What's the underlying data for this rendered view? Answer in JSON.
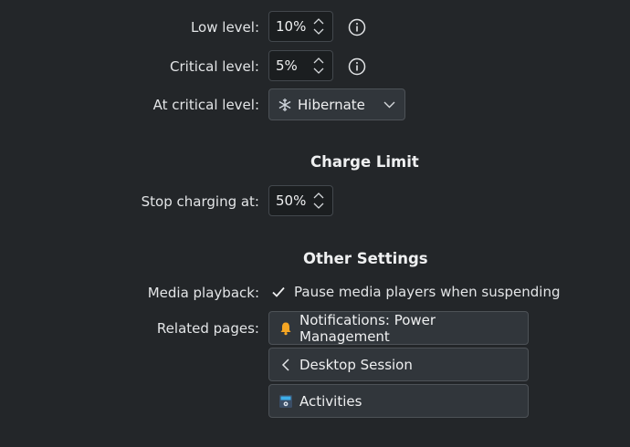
{
  "low_level": {
    "label": "Low level:",
    "value": "10%"
  },
  "critical_level": {
    "label": "Critical level:",
    "value": "5%"
  },
  "critical_action": {
    "label": "At critical level:",
    "value": "Hibernate",
    "icon": "snowflake-icon"
  },
  "charge_limit": {
    "heading": "Charge Limit",
    "label": "Stop charging at:",
    "value": "50%"
  },
  "other_settings": {
    "heading": "Other Settings",
    "media_label": "Media playback:",
    "media_checkbox": "Pause media players when suspending",
    "media_checked": true,
    "related_label": "Related pages:",
    "related_pages": [
      {
        "label": "Notifications: Power Management",
        "icon": "bell-icon"
      },
      {
        "label": "Desktop Session",
        "icon": "chevron-left-icon"
      },
      {
        "label": "Activities",
        "icon": "activities-icon"
      }
    ]
  },
  "colors": {
    "background": "#232629",
    "accent": "#3daee9",
    "bell": "#f5a623"
  }
}
